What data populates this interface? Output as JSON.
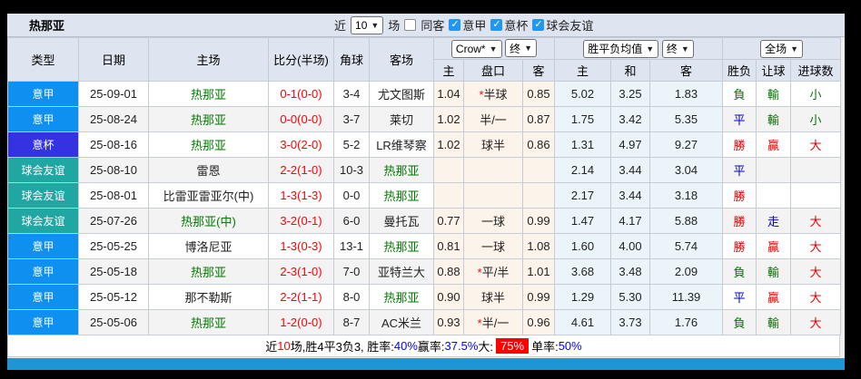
{
  "header": {
    "title": "热那亚",
    "near_label": "近",
    "count_select": "10",
    "matches_label": "场",
    "same_away_label": "同客",
    "filters": [
      {
        "label": "意甲",
        "checked": true
      },
      {
        "label": "意杯",
        "checked": true
      },
      {
        "label": "球会友谊",
        "checked": true
      }
    ]
  },
  "selects": {
    "bookmaker": "Crow*",
    "final1": "终",
    "odds_type": "胜平负均值",
    "final2": "终",
    "scope": "全场"
  },
  "columns": {
    "left": [
      "类型",
      "日期",
      "主场",
      "比分(半场)",
      "角球",
      "客场"
    ],
    "sub": [
      "主",
      "盘口",
      "客",
      "主",
      "和",
      "客",
      "胜负",
      "让球",
      "进球数"
    ]
  },
  "type_colors": {
    "意甲": "#0e90f0",
    "意杯": "#3433e2",
    "球会友谊": "#20a7a3"
  },
  "result_colors": {
    "勝": "#e60000",
    "平": "#0000cc",
    "負": "#007a00",
    "贏": "#e60000",
    "走": "#0000cc",
    "輸": "#007a00",
    "大": "#e60000",
    "小": "#007a00"
  },
  "rows": [
    {
      "type": "意甲",
      "date": "25-09-01",
      "home": "热那亚",
      "home_green": true,
      "score": "0-1",
      "half": "(0-0)",
      "corner": "3-4",
      "away": "尤文图斯",
      "away_green": false,
      "ah_home": "1.04",
      "ah_star": true,
      "ah_line": "半球",
      "ah_away": "0.85",
      "eu_home": "5.02",
      "eu_draw": "3.25",
      "eu_away": "1.83",
      "res_wdl": "負",
      "res_ah": "輸",
      "res_ou": "小"
    },
    {
      "type": "意甲",
      "date": "25-08-24",
      "home": "热那亚",
      "home_green": true,
      "score": "0-0",
      "half": "(0-0)",
      "corner": "3-7",
      "away": "莱切",
      "away_green": false,
      "ah_home": "1.02",
      "ah_star": false,
      "ah_line": "半/一",
      "ah_away": "0.87",
      "eu_home": "1.75",
      "eu_draw": "3.42",
      "eu_away": "5.35",
      "res_wdl": "平",
      "res_ah": "輸",
      "res_ou": "小"
    },
    {
      "type": "意杯",
      "date": "25-08-16",
      "home": "热那亚",
      "home_green": true,
      "score": "3-0",
      "half": "(2-0)",
      "corner": "5-2",
      "away": "LR维琴察",
      "away_green": false,
      "ah_home": "1.02",
      "ah_star": false,
      "ah_line": "球半",
      "ah_away": "0.86",
      "eu_home": "1.31",
      "eu_draw": "4.97",
      "eu_away": "9.27",
      "res_wdl": "勝",
      "res_ah": "贏",
      "res_ou": "大"
    },
    {
      "type": "球会友谊",
      "date": "25-08-10",
      "home": "雷恩",
      "home_green": false,
      "score": "2-2",
      "half": "(1-0)",
      "corner": "10-3",
      "away": "热那亚",
      "away_green": true,
      "ah_home": "",
      "ah_star": false,
      "ah_line": "",
      "ah_away": "",
      "eu_home": "2.14",
      "eu_draw": "3.44",
      "eu_away": "3.04",
      "res_wdl": "平",
      "res_ah": "",
      "res_ou": ""
    },
    {
      "type": "球会友谊",
      "date": "25-08-01",
      "home": "比雷亚雷亚尔(中)",
      "home_green": false,
      "score": "1-3",
      "half": "(1-3)",
      "corner": "0-0",
      "away": "热那亚",
      "away_green": true,
      "ah_home": "",
      "ah_star": false,
      "ah_line": "",
      "ah_away": "",
      "eu_home": "2.17",
      "eu_draw": "3.44",
      "eu_away": "3.18",
      "res_wdl": "勝",
      "res_ah": "",
      "res_ou": ""
    },
    {
      "type": "球会友谊",
      "date": "25-07-26",
      "home": "热那亚(中)",
      "home_green": true,
      "score": "3-2",
      "half": "(0-1)",
      "corner": "6-0",
      "away": "曼托瓦",
      "away_green": false,
      "ah_home": "0.77",
      "ah_star": false,
      "ah_line": "一球",
      "ah_away": "0.99",
      "eu_home": "1.47",
      "eu_draw": "4.17",
      "eu_away": "5.88",
      "res_wdl": "勝",
      "res_ah": "走",
      "res_ou": "大"
    },
    {
      "type": "意甲",
      "date": "25-05-25",
      "home": "博洛尼亚",
      "home_green": false,
      "score": "1-3",
      "half": "(0-3)",
      "corner": "13-1",
      "away": "热那亚",
      "away_green": true,
      "ah_home": "0.81",
      "ah_star": false,
      "ah_line": "一球",
      "ah_away": "1.08",
      "eu_home": "1.60",
      "eu_draw": "4.00",
      "eu_away": "5.74",
      "res_wdl": "勝",
      "res_ah": "贏",
      "res_ou": "大"
    },
    {
      "type": "意甲",
      "date": "25-05-18",
      "home": "热那亚",
      "home_green": true,
      "score": "2-3",
      "half": "(1-0)",
      "corner": "7-0",
      "away": "亚特兰大",
      "away_green": false,
      "ah_home": "0.88",
      "ah_star": true,
      "ah_line": "平/半",
      "ah_away": "1.01",
      "eu_home": "3.68",
      "eu_draw": "3.48",
      "eu_away": "2.09",
      "res_wdl": "負",
      "res_ah": "輸",
      "res_ou": "大"
    },
    {
      "type": "意甲",
      "date": "25-05-12",
      "home": "那不勒斯",
      "home_green": false,
      "score": "2-2",
      "half": "(1-1)",
      "corner": "8-0",
      "away": "热那亚",
      "away_green": true,
      "ah_home": "0.90",
      "ah_star": false,
      "ah_line": "球半",
      "ah_away": "0.99",
      "eu_home": "1.29",
      "eu_draw": "5.30",
      "eu_away": "11.39",
      "res_wdl": "平",
      "res_ah": "贏",
      "res_ou": "大"
    },
    {
      "type": "意甲",
      "date": "25-05-06",
      "home": "热那亚",
      "home_green": true,
      "score": "1-2",
      "half": "(0-0)",
      "corner": "8-7",
      "away": "AC米兰",
      "away_green": false,
      "ah_home": "0.93",
      "ah_star": true,
      "ah_line": "半/一",
      "ah_away": "0.96",
      "eu_home": "4.61",
      "eu_draw": "3.73",
      "eu_away": "1.76",
      "res_wdl": "負",
      "res_ah": "輸",
      "res_ou": "大"
    }
  ],
  "footer": {
    "segments": [
      {
        "text": "近",
        "style": "plain"
      },
      {
        "text": "10",
        "style": "red"
      },
      {
        "text": "场,胜4平3负3, 胜率:",
        "style": "plain"
      },
      {
        "text": "40%",
        "style": "blue"
      },
      {
        "text": " 赢率:",
        "style": "plain"
      },
      {
        "text": "37.5%",
        "style": "blue"
      },
      {
        "text": " 大:",
        "style": "plain"
      },
      {
        "text": "75%",
        "style": "highlight"
      },
      {
        "text": " 单率:",
        "style": "plain"
      },
      {
        "text": "50%",
        "style": "blue"
      }
    ]
  }
}
